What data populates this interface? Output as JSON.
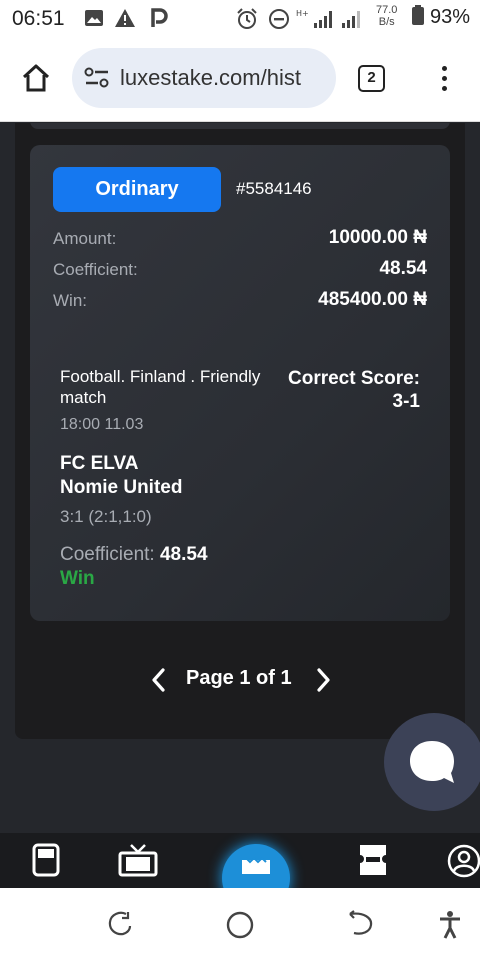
{
  "status_bar": {
    "time": "06:51",
    "net_speed_value": "77.0",
    "net_speed_unit": "B/s",
    "battery": "93%",
    "left_icons": [
      "gallery-icon",
      "warning-icon",
      "p-app-icon"
    ],
    "right_icons": [
      "alarm-icon",
      "dnd-icon",
      "signal-h-plus-icon",
      "signal-icon"
    ]
  },
  "browser": {
    "url": "luxestake.com/hist",
    "tab_count": "2"
  },
  "bet": {
    "type_label": "Ordinary",
    "id": "#5584146",
    "amount_label": "Amount:",
    "amount_value": "10000.00 ₦",
    "coefficient_label": "Coefficient:",
    "coefficient_value": "48.54",
    "win_label": "Win:",
    "win_value": "485400.00 ₦",
    "event": {
      "sport_line": "Football. Finland . Friendly match",
      "market": "Correct Score: 3-1",
      "time": "18:00 11.03",
      "team_home": "FC ELVA",
      "team_away": "Nomie United",
      "result": "3:1 (2:1,1:0)",
      "coefficient_label": "Coefficient:",
      "coefficient_value": "48.54",
      "status": "Win"
    }
  },
  "pagination": {
    "text": "Page 1 of 1"
  },
  "colors": {
    "accent": "#1578f0",
    "win": "#2aa845",
    "nav_center": "#1d8fd8"
  }
}
